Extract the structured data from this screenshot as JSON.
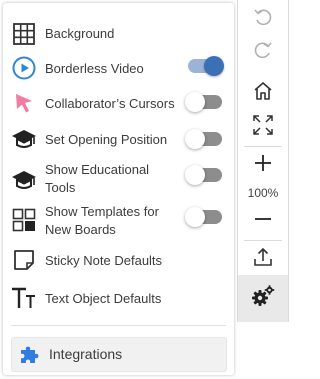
{
  "settings": {
    "items": [
      {
        "label": "Background",
        "icon": "grid-icon",
        "toggle": null
      },
      {
        "label": "Borderless Video",
        "icon": "play-circle-icon",
        "toggle": true
      },
      {
        "label": "Collaborator’s Cursors",
        "icon": "cursor-arrow-icon",
        "toggle": false
      },
      {
        "label": "Set Opening Position",
        "icon": "graduation-cap-icon",
        "toggle": false
      },
      {
        "label": "Show Educational",
        "label2": "Tools",
        "icon": "graduation-cap-icon",
        "toggle": false
      },
      {
        "label": "Show Templates for",
        "label2": "New Boards",
        "icon": "templates-icon",
        "toggle": false
      },
      {
        "label": "Sticky Note Defaults",
        "icon": "sticky-note-icon",
        "toggle": null
      },
      {
        "label": "Text Object Defaults",
        "icon": "text-icon",
        "toggle": null
      }
    ],
    "integrations_label": "Integrations"
  },
  "toolbar": {
    "zoom_level": "100%",
    "buttons": [
      "undo-icon",
      "redo-icon",
      "home-icon",
      "fit-screen-icon",
      "zoom-in-icon",
      "zoom-out-icon",
      "export-icon",
      "settings-icon"
    ]
  },
  "colors": {
    "accent": "#3b6fb6",
    "cursor_pink": "#f07ca0",
    "play_blue": "#2f86d6",
    "puzzle_blue": "#2f7de0"
  }
}
